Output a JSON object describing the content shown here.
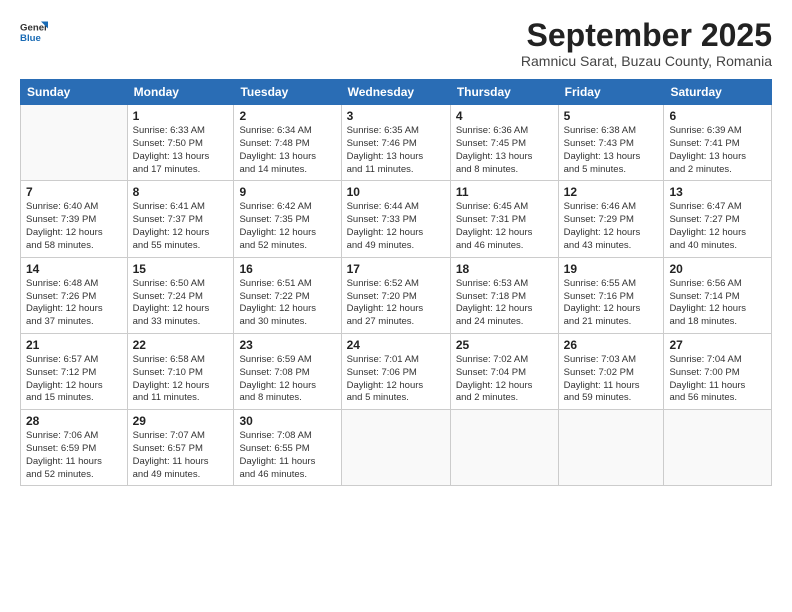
{
  "header": {
    "logo_general": "General",
    "logo_blue": "Blue",
    "month_title": "September 2025",
    "subtitle": "Ramnicu Sarat, Buzau County, Romania"
  },
  "weekdays": [
    "Sunday",
    "Monday",
    "Tuesday",
    "Wednesday",
    "Thursday",
    "Friday",
    "Saturday"
  ],
  "weeks": [
    [
      {
        "day": "",
        "info": ""
      },
      {
        "day": "1",
        "info": "Sunrise: 6:33 AM\nSunset: 7:50 PM\nDaylight: 13 hours\nand 17 minutes."
      },
      {
        "day": "2",
        "info": "Sunrise: 6:34 AM\nSunset: 7:48 PM\nDaylight: 13 hours\nand 14 minutes."
      },
      {
        "day": "3",
        "info": "Sunrise: 6:35 AM\nSunset: 7:46 PM\nDaylight: 13 hours\nand 11 minutes."
      },
      {
        "day": "4",
        "info": "Sunrise: 6:36 AM\nSunset: 7:45 PM\nDaylight: 13 hours\nand 8 minutes."
      },
      {
        "day": "5",
        "info": "Sunrise: 6:38 AM\nSunset: 7:43 PM\nDaylight: 13 hours\nand 5 minutes."
      },
      {
        "day": "6",
        "info": "Sunrise: 6:39 AM\nSunset: 7:41 PM\nDaylight: 13 hours\nand 2 minutes."
      }
    ],
    [
      {
        "day": "7",
        "info": "Sunrise: 6:40 AM\nSunset: 7:39 PM\nDaylight: 12 hours\nand 58 minutes."
      },
      {
        "day": "8",
        "info": "Sunrise: 6:41 AM\nSunset: 7:37 PM\nDaylight: 12 hours\nand 55 minutes."
      },
      {
        "day": "9",
        "info": "Sunrise: 6:42 AM\nSunset: 7:35 PM\nDaylight: 12 hours\nand 52 minutes."
      },
      {
        "day": "10",
        "info": "Sunrise: 6:44 AM\nSunset: 7:33 PM\nDaylight: 12 hours\nand 49 minutes."
      },
      {
        "day": "11",
        "info": "Sunrise: 6:45 AM\nSunset: 7:31 PM\nDaylight: 12 hours\nand 46 minutes."
      },
      {
        "day": "12",
        "info": "Sunrise: 6:46 AM\nSunset: 7:29 PM\nDaylight: 12 hours\nand 43 minutes."
      },
      {
        "day": "13",
        "info": "Sunrise: 6:47 AM\nSunset: 7:27 PM\nDaylight: 12 hours\nand 40 minutes."
      }
    ],
    [
      {
        "day": "14",
        "info": "Sunrise: 6:48 AM\nSunset: 7:26 PM\nDaylight: 12 hours\nand 37 minutes."
      },
      {
        "day": "15",
        "info": "Sunrise: 6:50 AM\nSunset: 7:24 PM\nDaylight: 12 hours\nand 33 minutes."
      },
      {
        "day": "16",
        "info": "Sunrise: 6:51 AM\nSunset: 7:22 PM\nDaylight: 12 hours\nand 30 minutes."
      },
      {
        "day": "17",
        "info": "Sunrise: 6:52 AM\nSunset: 7:20 PM\nDaylight: 12 hours\nand 27 minutes."
      },
      {
        "day": "18",
        "info": "Sunrise: 6:53 AM\nSunset: 7:18 PM\nDaylight: 12 hours\nand 24 minutes."
      },
      {
        "day": "19",
        "info": "Sunrise: 6:55 AM\nSunset: 7:16 PM\nDaylight: 12 hours\nand 21 minutes."
      },
      {
        "day": "20",
        "info": "Sunrise: 6:56 AM\nSunset: 7:14 PM\nDaylight: 12 hours\nand 18 minutes."
      }
    ],
    [
      {
        "day": "21",
        "info": "Sunrise: 6:57 AM\nSunset: 7:12 PM\nDaylight: 12 hours\nand 15 minutes."
      },
      {
        "day": "22",
        "info": "Sunrise: 6:58 AM\nSunset: 7:10 PM\nDaylight: 12 hours\nand 11 minutes."
      },
      {
        "day": "23",
        "info": "Sunrise: 6:59 AM\nSunset: 7:08 PM\nDaylight: 12 hours\nand 8 minutes."
      },
      {
        "day": "24",
        "info": "Sunrise: 7:01 AM\nSunset: 7:06 PM\nDaylight: 12 hours\nand 5 minutes."
      },
      {
        "day": "25",
        "info": "Sunrise: 7:02 AM\nSunset: 7:04 PM\nDaylight: 12 hours\nand 2 minutes."
      },
      {
        "day": "26",
        "info": "Sunrise: 7:03 AM\nSunset: 7:02 PM\nDaylight: 11 hours\nand 59 minutes."
      },
      {
        "day": "27",
        "info": "Sunrise: 7:04 AM\nSunset: 7:00 PM\nDaylight: 11 hours\nand 56 minutes."
      }
    ],
    [
      {
        "day": "28",
        "info": "Sunrise: 7:06 AM\nSunset: 6:59 PM\nDaylight: 11 hours\nand 52 minutes."
      },
      {
        "day": "29",
        "info": "Sunrise: 7:07 AM\nSunset: 6:57 PM\nDaylight: 11 hours\nand 49 minutes."
      },
      {
        "day": "30",
        "info": "Sunrise: 7:08 AM\nSunset: 6:55 PM\nDaylight: 11 hours\nand 46 minutes."
      },
      {
        "day": "",
        "info": ""
      },
      {
        "day": "",
        "info": ""
      },
      {
        "day": "",
        "info": ""
      },
      {
        "day": "",
        "info": ""
      }
    ]
  ]
}
